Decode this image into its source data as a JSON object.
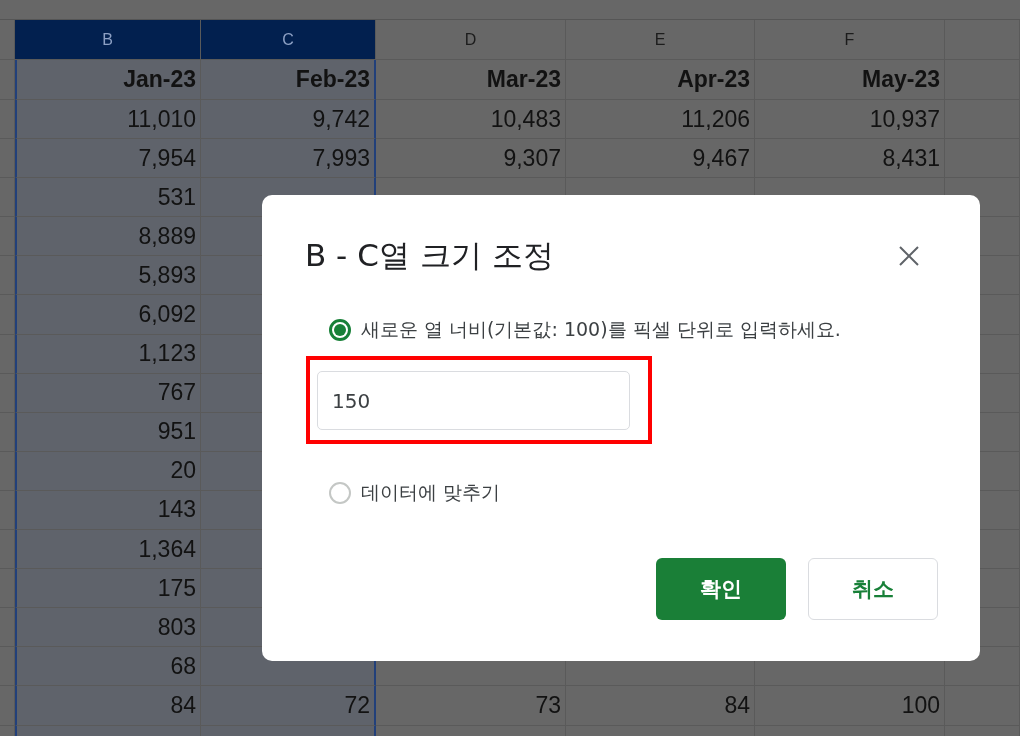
{
  "sheet": {
    "columns": [
      {
        "label": "B",
        "selected": true
      },
      {
        "label": "C",
        "selected": true
      },
      {
        "label": "D",
        "selected": false
      },
      {
        "label": "E",
        "selected": false
      },
      {
        "label": "F",
        "selected": false
      }
    ],
    "header_row": [
      "Jan-23",
      "Feb-23",
      "Mar-23",
      "Apr-23",
      "May-23"
    ],
    "rows": [
      {
        "cells": [
          "11,010",
          "9,742",
          "10,483",
          "11,206",
          "10,937"
        ]
      },
      {
        "cells": [
          "7,954",
          "7,993",
          "9,307",
          "9,467",
          "8,431"
        ]
      },
      {
        "cells": [
          "531"
        ]
      },
      {
        "cells": [
          "8,889"
        ]
      },
      {
        "cells": [
          "5,893"
        ]
      },
      {
        "cells": [
          "6,092"
        ]
      },
      {
        "cells": [
          "1,123"
        ]
      },
      {
        "cells": [
          "767"
        ]
      },
      {
        "cells": [
          "951"
        ]
      },
      {
        "cells": [
          "20"
        ]
      },
      {
        "cells": [
          "143"
        ]
      },
      {
        "cells": [
          "1,364"
        ]
      },
      {
        "cells": [
          "175"
        ]
      },
      {
        "cells": [
          "803"
        ]
      },
      {
        "cells": [
          "68"
        ]
      },
      {
        "cells": [
          "84",
          "72",
          "73",
          "84",
          "100"
        ]
      }
    ]
  },
  "dialog": {
    "title": "B - C열 크기 조정",
    "options": [
      {
        "label": "새로운 열 너비(기본값: 100)를 픽셀 단위로 입력하세요.",
        "selected": true
      },
      {
        "label": "데이터에 맞추기",
        "selected": false
      }
    ],
    "width_field": {
      "value": "150",
      "highlighted": true
    },
    "buttons": [
      {
        "label": "확인",
        "kind": "primary"
      },
      {
        "label": "취소",
        "kind": "secondary"
      }
    ]
  }
}
